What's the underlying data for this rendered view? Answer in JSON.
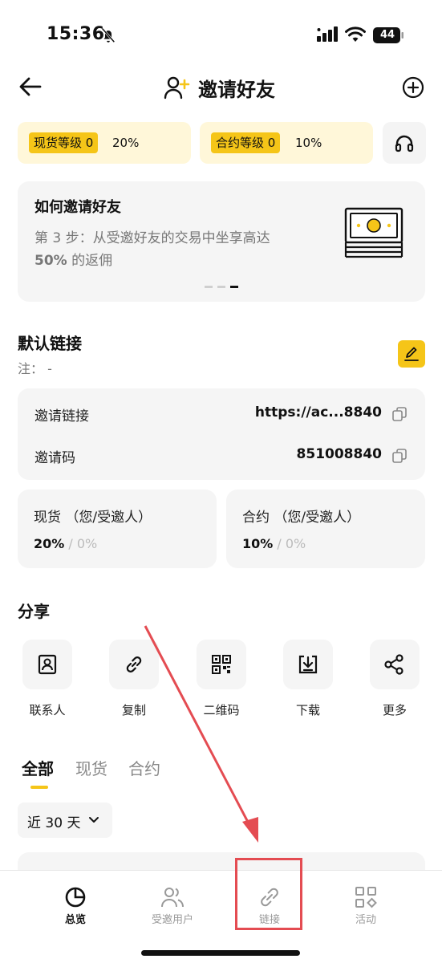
{
  "status_bar": {
    "time": "15:36",
    "battery": "44"
  },
  "header": {
    "title": "邀请好友"
  },
  "levels": {
    "spot_badge": "现货等级 0",
    "spot_rate": "20%",
    "contract_badge": "合约等级 0",
    "contract_rate": "10%"
  },
  "how_to": {
    "title": "如何邀请好友",
    "step_text": "第 3 步：从受邀好友的交易中坐享高达",
    "step_highlight": "50%",
    "step_suffix": " 的返佣",
    "current_slide": 3,
    "total_slides": 3
  },
  "default_link": {
    "title": "默认链接",
    "note": "注： -",
    "rows": [
      {
        "label": "邀请链接",
        "value": "https://ac...8840"
      },
      {
        "label": "邀请码",
        "value": "851008840"
      }
    ]
  },
  "rates": {
    "spot": {
      "title": "现货 （您/受邀人）",
      "main": "20%",
      "sub": " / 0%"
    },
    "contract": {
      "title": "合约 （您/受邀人）",
      "main": "10%",
      "sub": " / 0%"
    }
  },
  "share": {
    "title": "分享",
    "items": [
      {
        "label": "联系人",
        "icon": "contact-icon"
      },
      {
        "label": "复制",
        "icon": "link-icon"
      },
      {
        "label": "二维码",
        "icon": "qr-code-icon"
      },
      {
        "label": "下载",
        "icon": "download-icon"
      },
      {
        "label": "更多",
        "icon": "share-icon"
      }
    ]
  },
  "tabs": {
    "items": [
      "全部",
      "现货",
      "合约"
    ],
    "active": "全部"
  },
  "range": {
    "selected": "近 30 天"
  },
  "bottom_nav": {
    "items": [
      {
        "label": "总览",
        "icon": "pie-chart-icon",
        "active": true
      },
      {
        "label": "受邀用户",
        "icon": "users-icon",
        "active": false
      },
      {
        "label": "链接",
        "icon": "link-icon",
        "active": false
      },
      {
        "label": "活动",
        "icon": "grid-icon",
        "active": false
      }
    ]
  },
  "colors": {
    "accent": "#f5c518",
    "accent_bg": "#fff7d9",
    "card_bg": "#f5f5f5",
    "annotation": "#e44c52"
  }
}
